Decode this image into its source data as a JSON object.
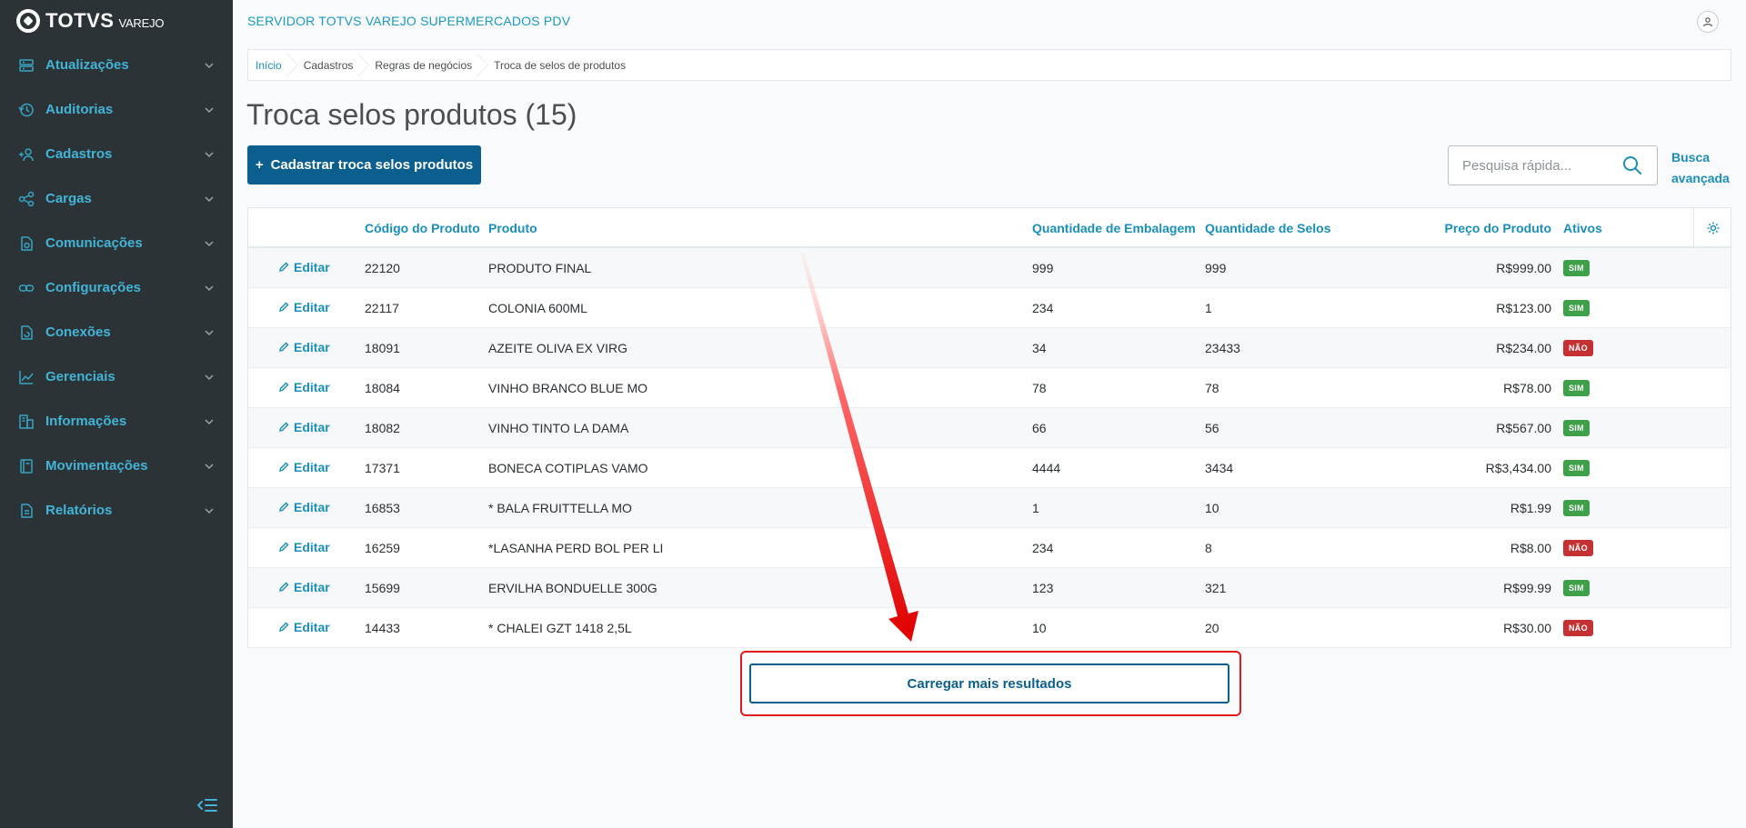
{
  "brand": {
    "name": "TOTVS",
    "sub": "VAREJO"
  },
  "sidebar": {
    "items": [
      {
        "label": "Atualizações",
        "icon": "server-icon"
      },
      {
        "label": "Auditorias",
        "icon": "history-icon"
      },
      {
        "label": "Cadastros",
        "icon": "add-user-icon"
      },
      {
        "label": "Cargas",
        "icon": "share-icon"
      },
      {
        "label": "Comunicações",
        "icon": "file-sync-icon"
      },
      {
        "label": "Configurações",
        "icon": "link-icon"
      },
      {
        "label": "Conexões",
        "icon": "file-refresh-icon"
      },
      {
        "label": "Gerenciais",
        "icon": "chart-icon"
      },
      {
        "label": "Informações",
        "icon": "building-icon"
      },
      {
        "label": "Movimentações",
        "icon": "notebook-icon"
      },
      {
        "label": "Relatórios",
        "icon": "document-icon"
      }
    ]
  },
  "header": {
    "server_title": "SERVIDOR TOTVS VAREJO SUPERMERCADOS PDV"
  },
  "breadcrumb": [
    "Início",
    "Cadastros",
    "Regras de negócios",
    "Troca de selos de produtos"
  ],
  "page": {
    "title": "Troca selos produtos (15)",
    "primary_button": "Cadastrar troca selos produtos",
    "primary_button_icon": "+"
  },
  "search": {
    "placeholder": "Pesquisa rápida...",
    "advanced_line1": "Busca",
    "advanced_line2": "avançada"
  },
  "table": {
    "columns": [
      "Código do Produto",
      "Produto",
      "Quantidade de Embalagem",
      "Quantidade de Selos",
      "Preço do Produto",
      "Ativos"
    ],
    "edit_label": "Editar",
    "rows": [
      {
        "code": "22120",
        "product": "PRODUTO FINAL",
        "pack_qty": "999",
        "seal_qty": "999",
        "price": "R$999.00",
        "active": "SIM"
      },
      {
        "code": "22117",
        "product": "COLONIA 600ML",
        "pack_qty": "234",
        "seal_qty": "1",
        "price": "R$123.00",
        "active": "SIM"
      },
      {
        "code": "18091",
        "product": "AZEITE OLIVA EX VIRG",
        "pack_qty": "34",
        "seal_qty": "23433",
        "price": "R$234.00",
        "active": "NÃO"
      },
      {
        "code": "18084",
        "product": "VINHO BRANCO BLUE MO",
        "pack_qty": "78",
        "seal_qty": "78",
        "price": "R$78.00",
        "active": "SIM"
      },
      {
        "code": "18082",
        "product": "VINHO TINTO LA DAMA",
        "pack_qty": "66",
        "seal_qty": "56",
        "price": "R$567.00",
        "active": "SIM"
      },
      {
        "code": "17371",
        "product": "BONECA COTIPLAS VAMO",
        "pack_qty": "4444",
        "seal_qty": "3434",
        "price": "R$3,434.00",
        "active": "SIM"
      },
      {
        "code": "16853",
        "product": "* BALA FRUITTELLA MO",
        "pack_qty": "1",
        "seal_qty": "10",
        "price": "R$1.99",
        "active": "SIM"
      },
      {
        "code": "16259",
        "product": "*LASANHA PERD BOL PER LI",
        "pack_qty": "234",
        "seal_qty": "8",
        "price": "R$8.00",
        "active": "NÃO"
      },
      {
        "code": "15699",
        "product": "ERVILHA BONDUELLE 300G",
        "pack_qty": "123",
        "seal_qty": "321",
        "price": "R$99.99",
        "active": "SIM"
      },
      {
        "code": "14433",
        "product": "* CHALEI GZT 1418 2,5L",
        "pack_qty": "10",
        "seal_qty": "20",
        "price": "R$30.00",
        "active": "NÃO"
      }
    ]
  },
  "load_more": "Carregar mais resultados",
  "colors": {
    "sidebar_bg": "#2c3337",
    "accent": "#1a8fb8",
    "primary": "#0b5f8f",
    "badge_yes": "#3fa04a",
    "badge_no": "#c53133",
    "annotation": "#e21a1a"
  }
}
